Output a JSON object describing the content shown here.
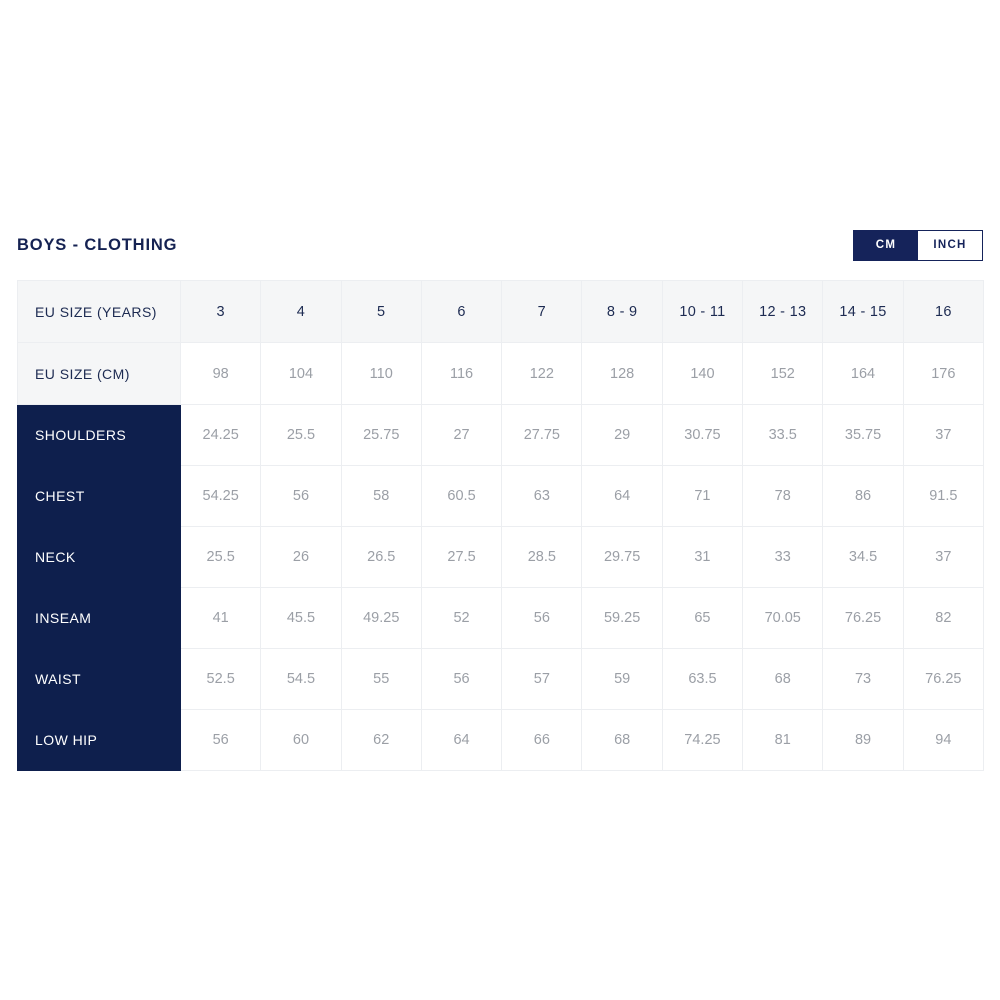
{
  "header": {
    "title": "BOYS - CLOTHING",
    "unit_toggle": {
      "active_unit": "CM",
      "options": [
        {
          "label": "CM",
          "active": true
        },
        {
          "label": "INCH",
          "active": false
        }
      ]
    }
  },
  "colors": {
    "navy": "#0e1f4d",
    "title_navy": "#152252",
    "toggle_navy": "#15235a",
    "header_gray": "#f5f6f7",
    "value_gray": "#9b9fa6",
    "border_gray": "#eceef1"
  },
  "chart_data": {
    "type": "table",
    "title": "BOYS - CLOTHING",
    "unit": "CM",
    "columns": [
      {
        "key": "label",
        "header": ""
      },
      {
        "key": "c1",
        "header": "3"
      },
      {
        "key": "c2",
        "header": "4"
      },
      {
        "key": "c3",
        "header": "5"
      },
      {
        "key": "c4",
        "header": "6"
      },
      {
        "key": "c5",
        "header": "7"
      },
      {
        "key": "c6",
        "header": "8 - 9"
      },
      {
        "key": "c7",
        "header": "10 - 11"
      },
      {
        "key": "c8",
        "header": "12 - 13"
      },
      {
        "key": "c9",
        "header": "14 - 15"
      },
      {
        "key": "c10",
        "header": "16"
      }
    ],
    "header_rows": [
      {
        "label": "EU SIZE (YEARS)",
        "values": [
          "3",
          "4",
          "5",
          "6",
          "7",
          "8 - 9",
          "10 - 11",
          "12 - 13",
          "14 - 15",
          "16"
        ]
      },
      {
        "label": "EU SIZE (CM)",
        "values": [
          "98",
          "104",
          "110",
          "116",
          "122",
          "128",
          "140",
          "152",
          "164",
          "176"
        ]
      }
    ],
    "rows": [
      {
        "label": "SHOULDERS",
        "values": [
          "24.25",
          "25.5",
          "25.75",
          "27",
          "27.75",
          "29",
          "30.75",
          "33.5",
          "35.75",
          "37"
        ]
      },
      {
        "label": "CHEST",
        "values": [
          "54.25",
          "56",
          "58",
          "60.5",
          "63",
          "64",
          "71",
          "78",
          "86",
          "91.5"
        ]
      },
      {
        "label": "NECK",
        "values": [
          "25.5",
          "26",
          "26.5",
          "27.5",
          "28.5",
          "29.75",
          "31",
          "33",
          "34.5",
          "37"
        ]
      },
      {
        "label": "INSEAM",
        "values": [
          "41",
          "45.5",
          "49.25",
          "52",
          "56",
          "59.25",
          "65",
          "70.05",
          "76.25",
          "82"
        ]
      },
      {
        "label": "WAIST",
        "values": [
          "52.5",
          "54.5",
          "55",
          "56",
          "57",
          "59",
          "63.5",
          "68",
          "73",
          "76.25"
        ]
      },
      {
        "label": "LOW HIP",
        "values": [
          "56",
          "60",
          "62",
          "64",
          "66",
          "68",
          "74.25",
          "81",
          "89",
          "94"
        ]
      }
    ]
  }
}
